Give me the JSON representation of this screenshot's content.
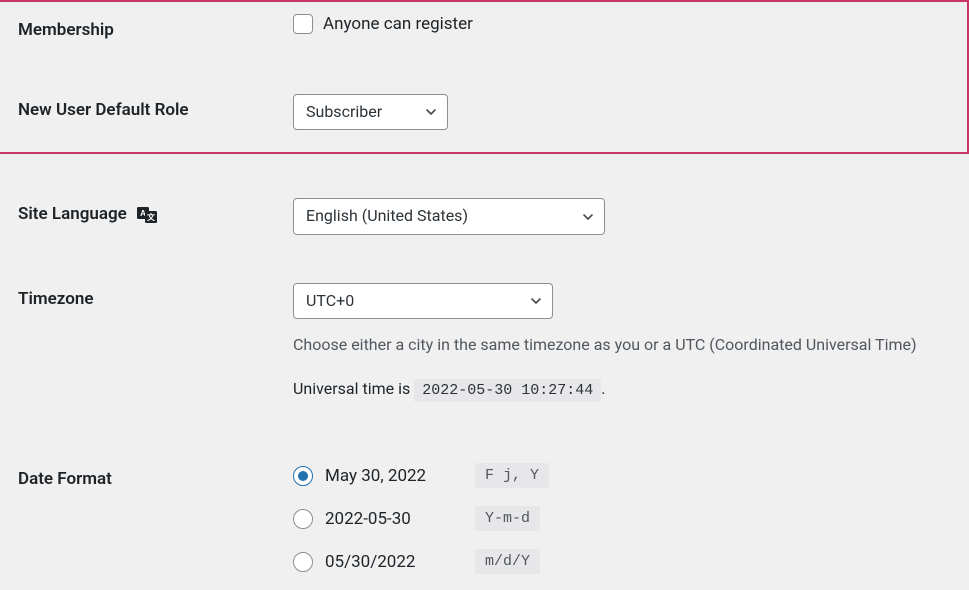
{
  "membership": {
    "label": "Membership",
    "checkbox_label": "Anyone can register",
    "checked": false
  },
  "new_user_role": {
    "label": "New User Default Role",
    "selected": "Subscriber"
  },
  "site_language": {
    "label": "Site Language",
    "selected": "English (United States)"
  },
  "timezone": {
    "label": "Timezone",
    "selected": "UTC+0",
    "description": "Choose either a city in the same timezone as you or a UTC (Coordinated Universal Time)",
    "universal_prefix": "Universal time is",
    "universal_time": "2022-05-30 10:27:44",
    "universal_suffix": "."
  },
  "date_format": {
    "label": "Date Format",
    "options": [
      {
        "display": "May 30, 2022",
        "code": "F j, Y",
        "checked": true
      },
      {
        "display": "2022-05-30",
        "code": "Y-m-d",
        "checked": false
      },
      {
        "display": "05/30/2022",
        "code": "m/d/Y",
        "checked": false
      }
    ]
  }
}
